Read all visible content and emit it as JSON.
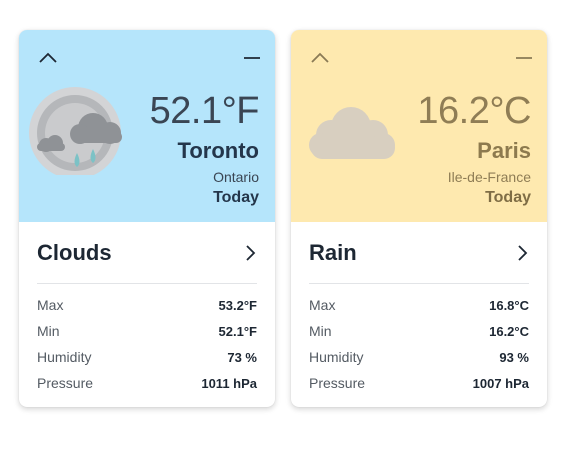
{
  "cards": [
    {
      "temperature": "52.1°F",
      "city": "Toronto",
      "region": "Ontario",
      "day": "Today",
      "condition": "Clouds",
      "icon": "rain-clouds-moon-icon",
      "theme_color": "#b5e5fb",
      "stats": [
        {
          "label": "Max",
          "value": "53.2°F"
        },
        {
          "label": "Min",
          "value": "52.1°F"
        },
        {
          "label": "Humidity",
          "value": "73 %"
        },
        {
          "label": "Pressure",
          "value": "1011 hPa"
        }
      ]
    },
    {
      "temperature": "16.2°C",
      "city": "Paris",
      "region": "Ile-de-France",
      "day": "Today",
      "condition": "Rain",
      "icon": "cloud-icon",
      "theme_color": "#fee9af",
      "stats": [
        {
          "label": "Max",
          "value": "16.8°C"
        },
        {
          "label": "Min",
          "value": "16.2°C"
        },
        {
          "label": "Humidity",
          "value": "93 %"
        },
        {
          "label": "Pressure",
          "value": "1007 hPa"
        }
      ]
    }
  ]
}
